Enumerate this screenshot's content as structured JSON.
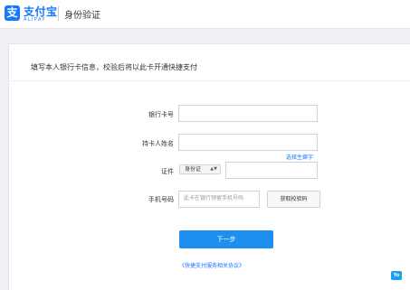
{
  "header": {
    "logo_icon": "支",
    "logo_text": "支付宝",
    "logo_sub": "ALIPAY",
    "title": "身份验证"
  },
  "intro": "填写本人银行卡信息，校验后将以此卡开通快捷支付",
  "form": {
    "card_number": {
      "label": "银行卡号",
      "value": ""
    },
    "holder_name": {
      "label": "持卡人姓名",
      "value": "",
      "rare_char_link": "选择生僻字"
    },
    "id_doc": {
      "label": "证件",
      "type_selected": "身份证",
      "value": ""
    },
    "phone": {
      "label": "手机号码",
      "placeholder": "此卡在银行预留手机号码",
      "get_code_label": "获取校验码"
    }
  },
  "next_button": "下一步",
  "agreement_link": "《快捷支付服务相关协议》",
  "corner_badge": "Yo",
  "colors": {
    "brand": "#1677ff",
    "primary_button": "#1d8ff0",
    "page_bg": "#eef0f4"
  }
}
